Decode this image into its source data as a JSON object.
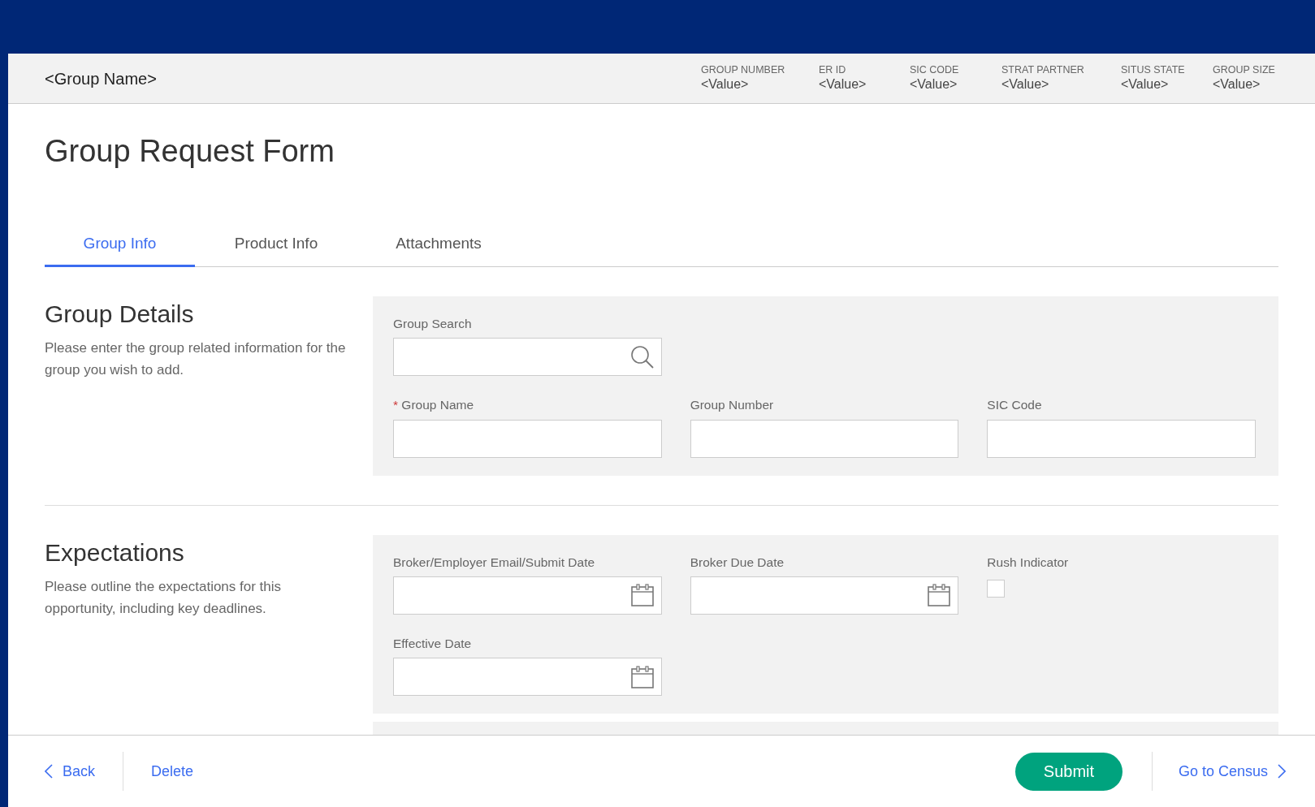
{
  "header": {
    "group_name": "<Group Name>",
    "fields": [
      {
        "label": "GROUP NUMBER",
        "value": "<Value>"
      },
      {
        "label": "ER ID",
        "value": "<Value>"
      },
      {
        "label": "SIC CODE",
        "value": "<Value>"
      },
      {
        "label": "STRAT PARTNER",
        "value": "<Value>"
      },
      {
        "label": "SITUS STATE",
        "value": "<Value>"
      },
      {
        "label": "GROUP SIZE",
        "value": "<Value>"
      }
    ]
  },
  "page_title": "Group Request Form",
  "tabs": [
    {
      "label": "Group Info",
      "selected": true
    },
    {
      "label": "Product Info",
      "selected": false
    },
    {
      "label": "Attachments",
      "selected": false
    }
  ],
  "sections": [
    {
      "title": "Group Details",
      "description": "Please enter the group related information for the group you wish to add.",
      "rows": [
        [
          {
            "kind": "search",
            "label": "Group Search"
          }
        ],
        [
          {
            "kind": "text",
            "label": "Group Name",
            "marker": "*"
          },
          {
            "kind": "text",
            "label": "Group Number"
          },
          {
            "kind": "text",
            "label": "SIC Code"
          }
        ]
      ]
    },
    {
      "title": "Expectations",
      "description": "Please outline the expectations for this opportunity, including key deadlines.",
      "rows": [
        [
          {
            "kind": "date",
            "label": "Broker/Employer Email/Submit Date"
          },
          {
            "kind": "date",
            "label": "Broker Due Date"
          },
          {
            "kind": "checkbox",
            "label": "Rush Indicator",
            "checked": false
          }
        ],
        [
          {
            "kind": "date",
            "label": "Effective Date"
          }
        ]
      ]
    }
  ],
  "footer": {
    "back": "Back",
    "delete": "Delete",
    "submit": "Submit",
    "next": "Go to Census"
  }
}
